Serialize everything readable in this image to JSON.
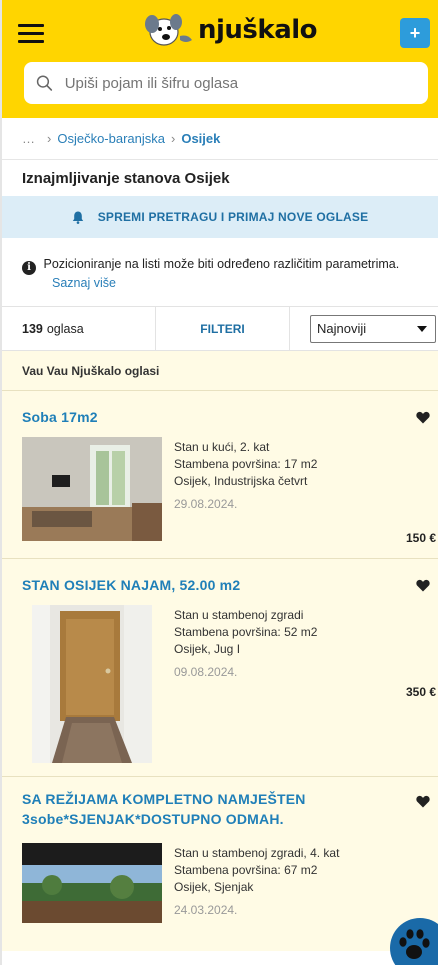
{
  "header": {
    "logo_text": "njuškalo",
    "plus_label": "+",
    "search_placeholder": "Upiši pojam ili šifru oglasa"
  },
  "breadcrumb": {
    "ellipsis": "…",
    "items": [
      "Osječko-baranjska",
      "Osijek"
    ]
  },
  "page_title": "Iznajmljivanje stanova Osijek",
  "save_search_label": "SPREMI PRETRAGU I PRIMAJ NOVE OGLASE",
  "info": {
    "text": "Pozicioniranje na listi može biti određeno različitim parametrima.",
    "link": "Saznaj više"
  },
  "controls": {
    "count_number": "139",
    "count_suffix": "oglasa",
    "filters_label": "FILTERI",
    "sort_value": "Najnoviji"
  },
  "section_label": "Vau Vau Njuškalo oglasi",
  "listings": [
    {
      "title": "Soba 17m2",
      "details": [
        "Stan u kući, 2. kat",
        "Stambena površina: 17 m2",
        "Osijek, Industrijska četvrt"
      ],
      "date": "29.08.2024.",
      "price": "150 €"
    },
    {
      "title": "STAN OSIJEK NAJAM, 52.00 m2",
      "details": [
        "Stan u stambenoj zgradi",
        "Stambena površina: 52 m2",
        "Osijek, Jug I"
      ],
      "date": "09.08.2024.",
      "price": "350 €"
    },
    {
      "title_line1": "SA REŽIJAMA KOMPLETNO NAMJEŠTEN",
      "title_line2": "3sobe*SJENJAK*DOSTUPNO ODMAH.",
      "details": [
        "Stan u stambenoj zgradi, 4. kat",
        "Stambena površina: 67 m2",
        "Osijek, Sjenjak"
      ],
      "date": "24.03.2024."
    }
  ],
  "colors": {
    "brand_yellow": "#ffd500",
    "link_blue": "#1f7fb8",
    "listing_bg": "#fffbe5",
    "save_search_bg": "#dcedf7",
    "paw_button": "#1a6aa8"
  },
  "icons": [
    "menu-icon",
    "dog-logo-icon",
    "plus-icon",
    "search-icon",
    "bell-icon",
    "info-icon",
    "chevron-down-icon",
    "heart-icon",
    "paw-icon"
  ]
}
